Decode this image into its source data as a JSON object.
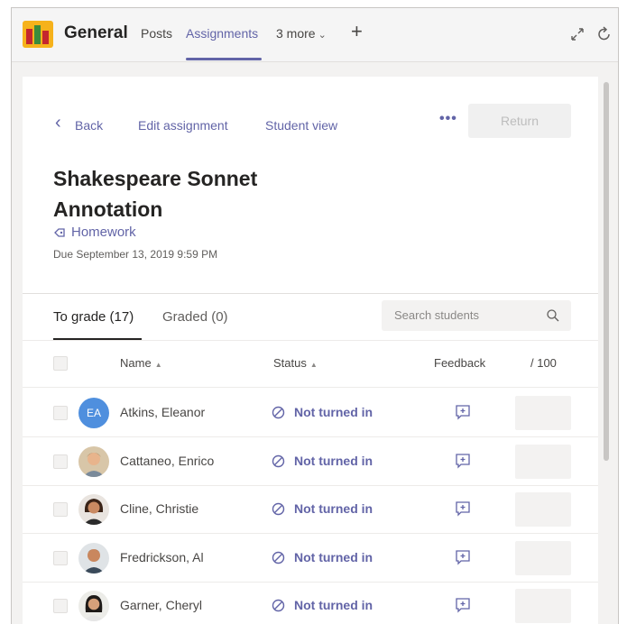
{
  "header": {
    "team_name": "General",
    "tabs": [
      {
        "label": "Posts"
      },
      {
        "label": "Assignments"
      }
    ],
    "more_label": "3 more"
  },
  "toolbar": {
    "back_label": "Back",
    "edit_label": "Edit assignment",
    "student_view_label": "Student view",
    "return_label": "Return"
  },
  "assignment": {
    "title": "Shakespeare Sonnet Annotation",
    "category": "Homework",
    "due": "Due September 13, 2019 9:59 PM"
  },
  "grading": {
    "to_grade_label": "To grade (17)",
    "graded_label": "Graded (0)",
    "search_placeholder": "Search students",
    "columns": {
      "name": "Name",
      "status": "Status",
      "feedback": "Feedback",
      "points": "/ 100"
    },
    "students": [
      {
        "name": "Atkins, Eleanor",
        "initials": "EA",
        "status": "Not turned in"
      },
      {
        "name": "Cattaneo, Enrico",
        "status": "Not turned in"
      },
      {
        "name": "Cline, Christie",
        "status": "Not turned in"
      },
      {
        "name": "Fredrickson, Al",
        "status": "Not turned in"
      },
      {
        "name": "Garner, Cheryl",
        "status": "Not turned in"
      }
    ]
  },
  "colors": {
    "accent": "#6264a7",
    "initials_avatar": "#4f8fde"
  },
  "icons": [
    "team-logo-icon",
    "chevron-down-icon",
    "plus-icon",
    "expand-icon",
    "refresh-icon",
    "back-chevron-icon",
    "more-icon",
    "category-tag-icon",
    "search-icon",
    "sort-up-icon",
    "not-turned-in-icon",
    "feedback-icon"
  ]
}
